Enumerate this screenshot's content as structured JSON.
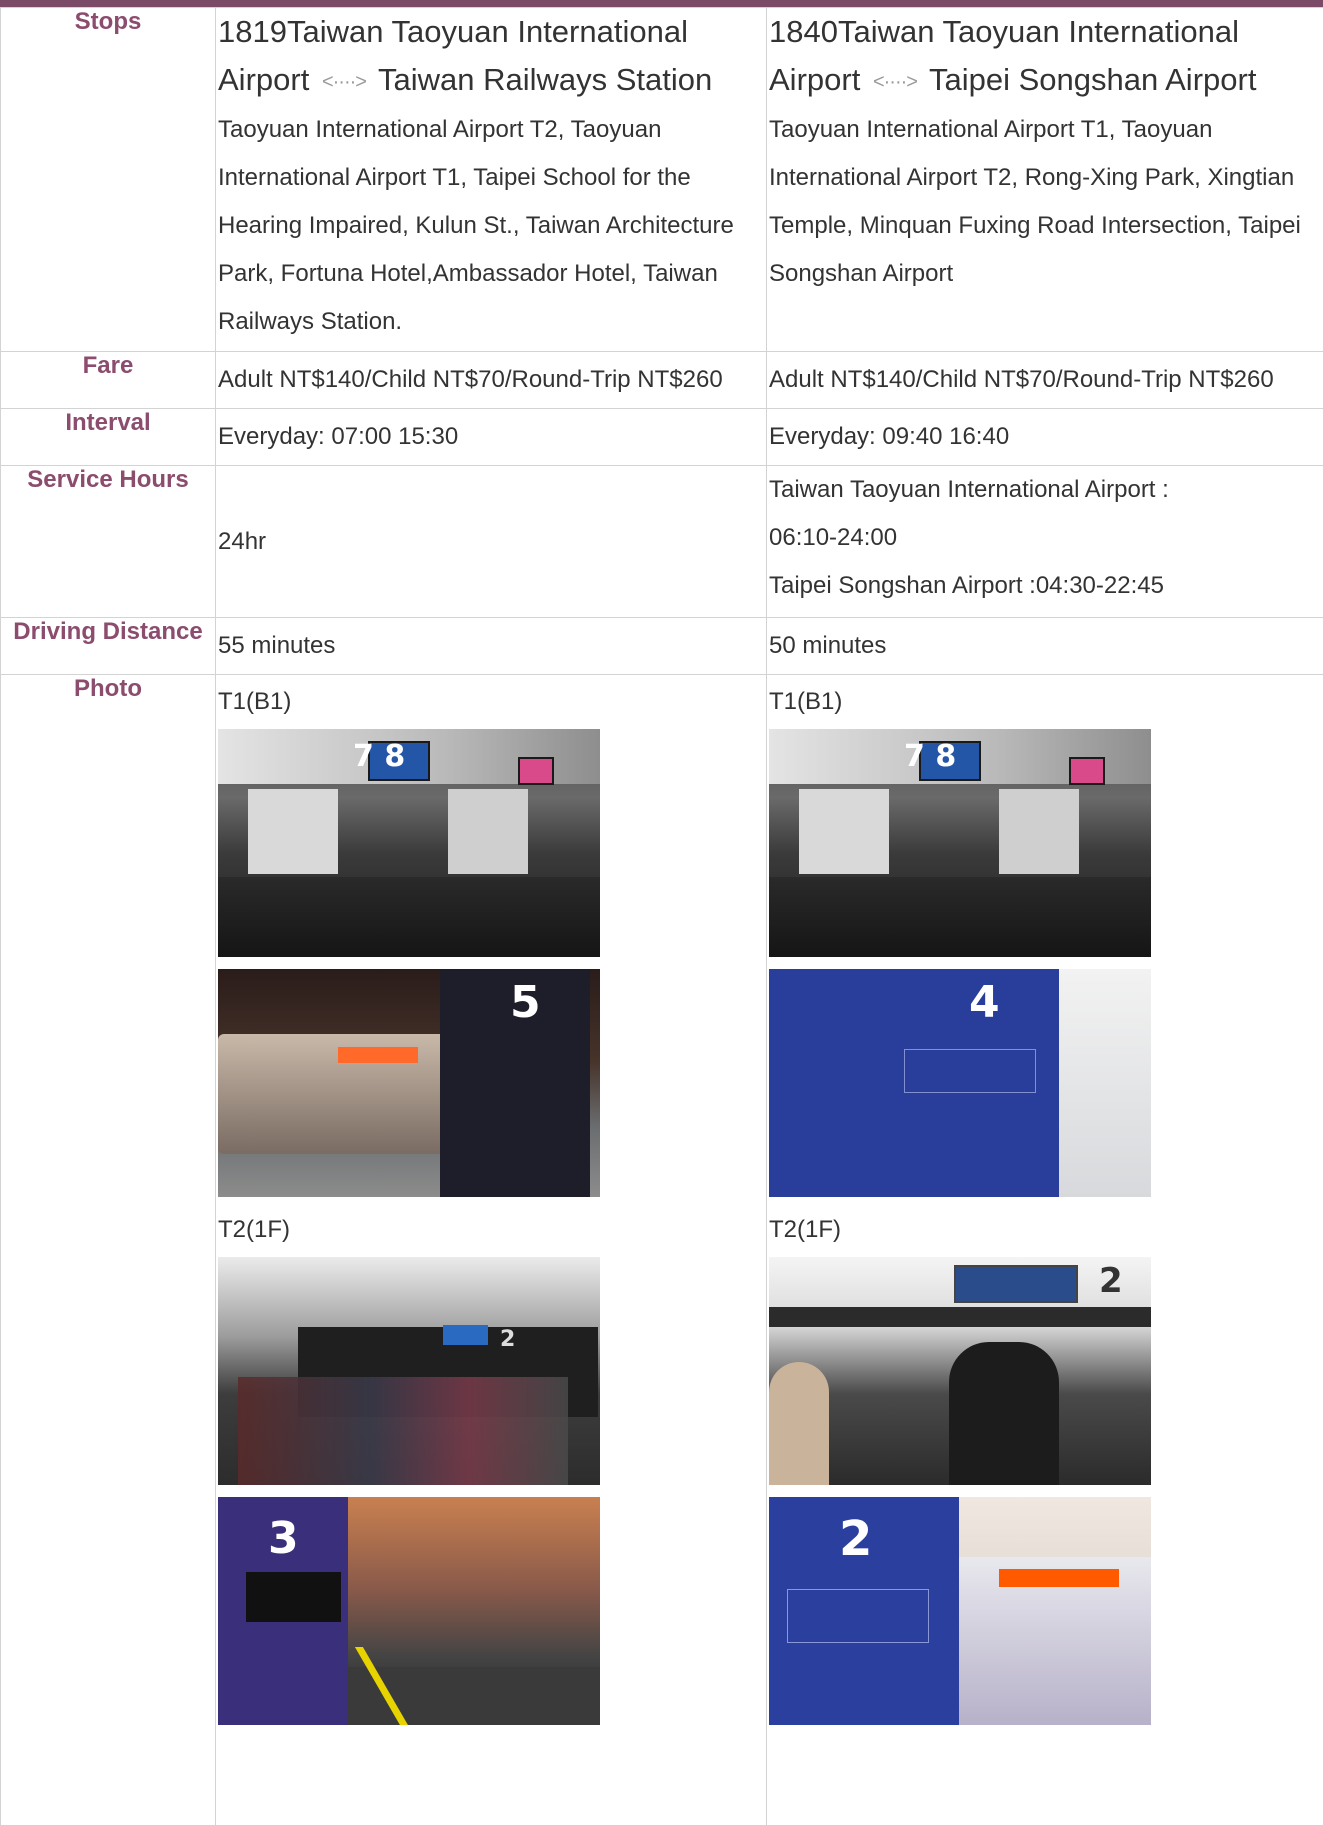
{
  "header": {
    "title": ""
  },
  "rows": {
    "stops_label": "Stops",
    "fare_label": "Fare",
    "interval_label": "Interval",
    "service_label": "Service Hours",
    "distance_label": "Driving Distance",
    "photo_label": "Photo"
  },
  "routes": [
    {
      "route_no": "1819",
      "from": "Taiwan Taoyuan International Airport",
      "to": "Taiwan Railways Station",
      "stops": "Taoyuan International Airport T2, Taoyuan International Airport T1, Taipei School for the Hearing Impaired, Kulun St., Taiwan Architecture Park, Fortuna Hotel,Ambassador Hotel, Taiwan Railways Station.",
      "fare": "Adult NT$140/Child NT$70/Round-Trip NT$260",
      "interval": "Everyday: 07:00 15:30",
      "service_line1": "24hr",
      "service_line2": "",
      "service_line3": "",
      "distance": "55 minutes",
      "photo_label_t1": "T1(B1)",
      "photo_label_t2": "T2(1F)",
      "photos": {
        "p1_num": "7 8",
        "p2_num": "5",
        "p3_num": "2",
        "p4_num": "3"
      }
    },
    {
      "route_no": "1840",
      "from": "Taiwan Taoyuan International Airport",
      "to": "Taipei Songshan Airport",
      "stops": "Taoyuan International Airport T1, Taoyuan International Airport T2, Rong-Xing Park, Xingtian Temple, Minquan Fuxing Road Intersection, Taipei Songshan Airport",
      "fare": "Adult NT$140/Child NT$70/Round-Trip NT$260",
      "interval": "Everyday: 09:40 16:40",
      "service_line1": "Taiwan Taoyuan International Airport :",
      "service_line2": "06:10-24:00",
      "service_line3": "Taipei Songshan Airport :04:30-22:45",
      "distance": "50 minutes",
      "photo_label_t1": "T1(B1)",
      "photo_label_t2": "T2(1F)",
      "photos": {
        "p1_num": "7 8",
        "p2_num": "4",
        "p3_num": "2",
        "p4_num": "2"
      }
    }
  ],
  "icons": {
    "arrow": "double-arrow-icon"
  },
  "colors": {
    "label": "#8b4c6e",
    "topbar": "#7a4a66",
    "border": "#d3d3d3"
  }
}
